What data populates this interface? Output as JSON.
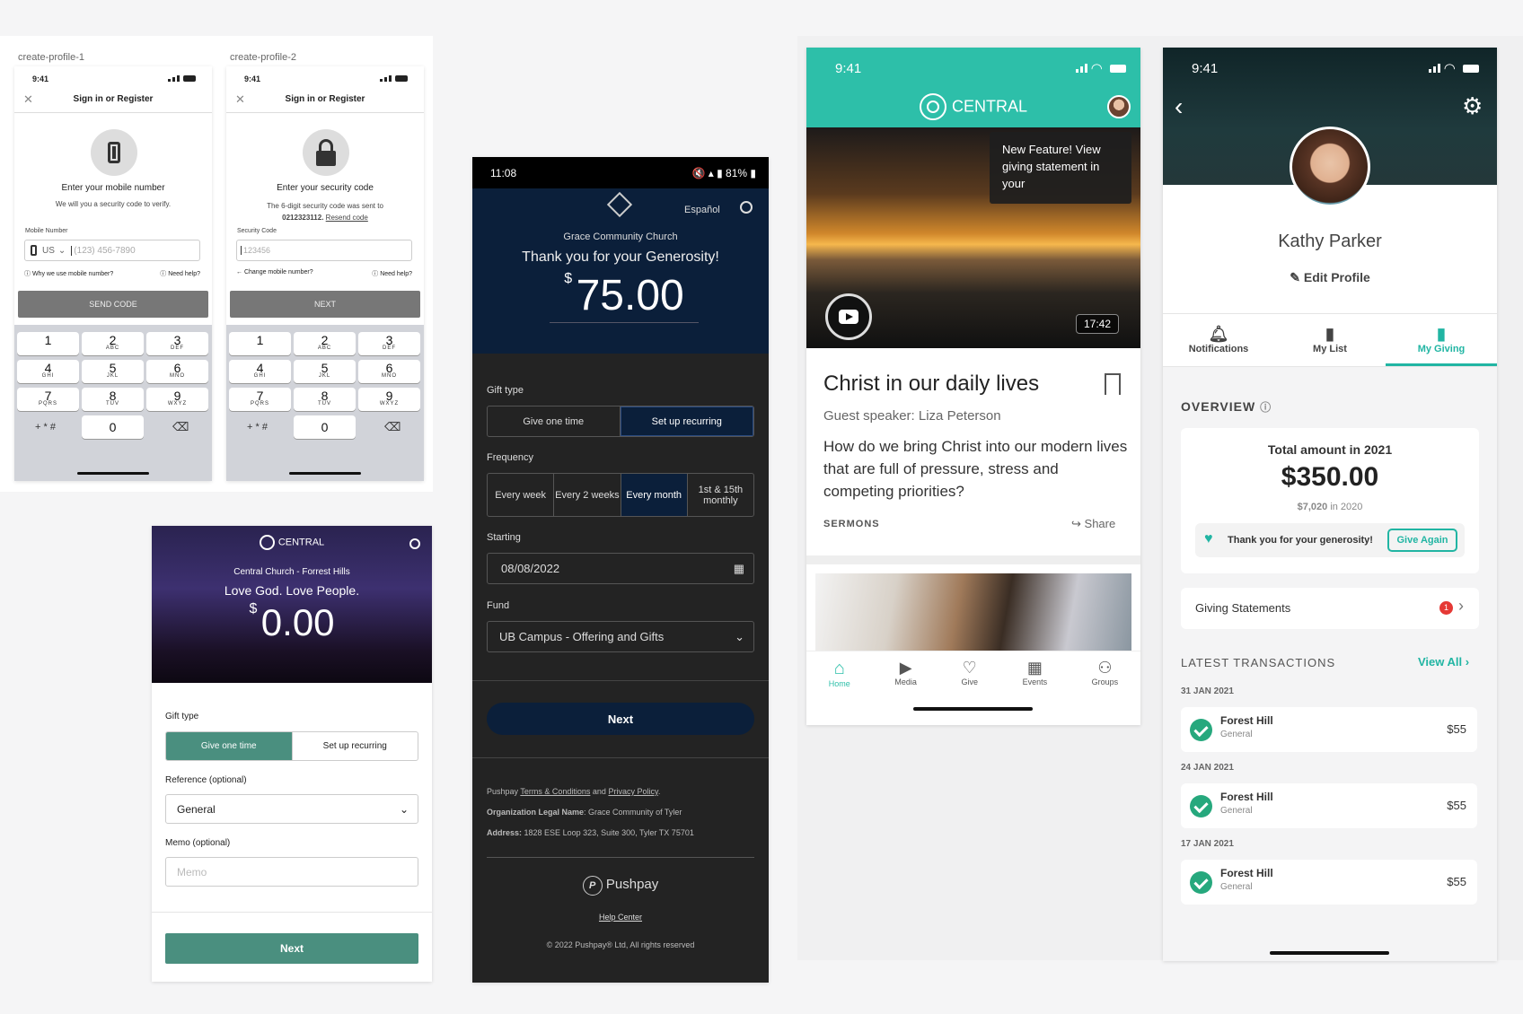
{
  "p1": {
    "label": "create-profile-1",
    "time": "9:41",
    "title": "Sign in or Register",
    "heading": "Enter your mobile number",
    "sub": "We will you a security code to verify.",
    "field_label": "Mobile Number",
    "country": "US",
    "placeholder": "(123) 456-7890",
    "why": "Why we use mobile number?",
    "help": "Need help?",
    "button": "SEND CODE"
  },
  "p2": {
    "label": "create-profile-2",
    "time": "9:41",
    "title": "Sign in or Register",
    "heading": "Enter your security code",
    "sub1": "The 6-digit security code was sent to",
    "number": "0212323112.",
    "resend": "Resend code",
    "field_label": "Security Code",
    "placeholder": "123456",
    "change": "Change mobile number?",
    "help": "Need help?",
    "button": "NEXT"
  },
  "keypad": [
    [
      "1",
      ""
    ],
    [
      "2",
      "ABC"
    ],
    [
      "3",
      "DEF"
    ],
    [
      "4",
      "GHI"
    ],
    [
      "5",
      "JKL"
    ],
    [
      "6",
      "MNO"
    ],
    [
      "7",
      "PQRS"
    ],
    [
      "8",
      "TUV"
    ],
    [
      "9",
      "WXYZ"
    ]
  ],
  "keypad_extra": {
    "sym": "+ * #",
    "zero": "0"
  },
  "pp": {
    "time": "11:08",
    "status": "81%",
    "lang": "Español",
    "church": "Grace Community Church",
    "thanks": "Thank you for your Generosity!",
    "currency": "$",
    "amount": "75.00",
    "gift_type": "Gift type",
    "give_once": "Give one time",
    "recurring": "Set up recurring",
    "frequency": "Frequency",
    "freq": [
      "Every week",
      "Every 2 weeks",
      "Every month",
      "1st & 15th monthly"
    ],
    "starting": "Starting",
    "date": "08/08/2022",
    "fund_label": "Fund",
    "fund": "UB Campus - Offering and Gifts",
    "next": "Next",
    "legal_prefix": "Pushpay",
    "terms": "Terms & Conditions",
    "and": "and",
    "privacy": "Privacy Policy",
    "org_label": "Organization Legal Name",
    "org": "Grace Community of Tyler",
    "addr_label": "Address:",
    "addr": "1828 ESE Loop 323, Suite 300, Tyler TX 75701",
    "brand": "Pushpay",
    "help": "Help Center",
    "copyright": "© 2022 Pushpay® Ltd, All rights reserved"
  },
  "cg": {
    "brand": "CENTRAL",
    "church": "Central Church - Forrest Hills",
    "tagline": "Love God. Love People.",
    "currency": "$",
    "amount": "0.00",
    "gift_type": "Gift type",
    "give_once": "Give one time",
    "recurring": "Set up recurring",
    "ref_label": "Reference (optional)",
    "ref": "General",
    "memo_label": "Memo (optional)",
    "memo_placeholder": "Memo",
    "next": "Next"
  },
  "ca": {
    "time": "9:41",
    "brand": "CENTRAL",
    "tooltip": "New Feature! View giving statement in your",
    "duration": "17:42",
    "title": "Christ in our daily lives",
    "speaker": "Guest speaker: Liza Peterson",
    "desc": "How do we bring Christ into our modern lives that are full of pressure, stress and competing priorities?",
    "category": "SERMONS",
    "share": "Share",
    "nav": [
      "Home",
      "Media",
      "Give",
      "Events",
      "Groups"
    ]
  },
  "pr": {
    "time": "9:41",
    "name": "Kathy Parker",
    "edit": "Edit Profile",
    "tabs": [
      "Notifications",
      "My List",
      "My Giving"
    ],
    "overview": "OVERVIEW",
    "total_label": "Total amount in 2021",
    "total": "$350.00",
    "prev_amount": "$7,020",
    "prev_label": "in 2020",
    "thanks": "Thank you for your generosity!",
    "give_again": "Give Again",
    "statements": "Giving Statements",
    "badge": "1",
    "latest": "LATEST TRANSACTIONS",
    "view_all": "View All",
    "transactions": [
      {
        "date": "31 JAN 2021",
        "name": "Forest Hill",
        "fund": "General",
        "amount": "$55"
      },
      {
        "date": "24 JAN 2021",
        "name": "Forest Hill",
        "fund": "General",
        "amount": "$55"
      },
      {
        "date": "17 JAN 2021",
        "name": "Forest Hill",
        "fund": "General",
        "amount": "$55"
      }
    ]
  },
  "colors": {
    "teal": "#2dbfa9",
    "green": "#4a8f7f",
    "navy": "#0b1f3a",
    "dark": "#222",
    "accent": "#21b5a3"
  }
}
